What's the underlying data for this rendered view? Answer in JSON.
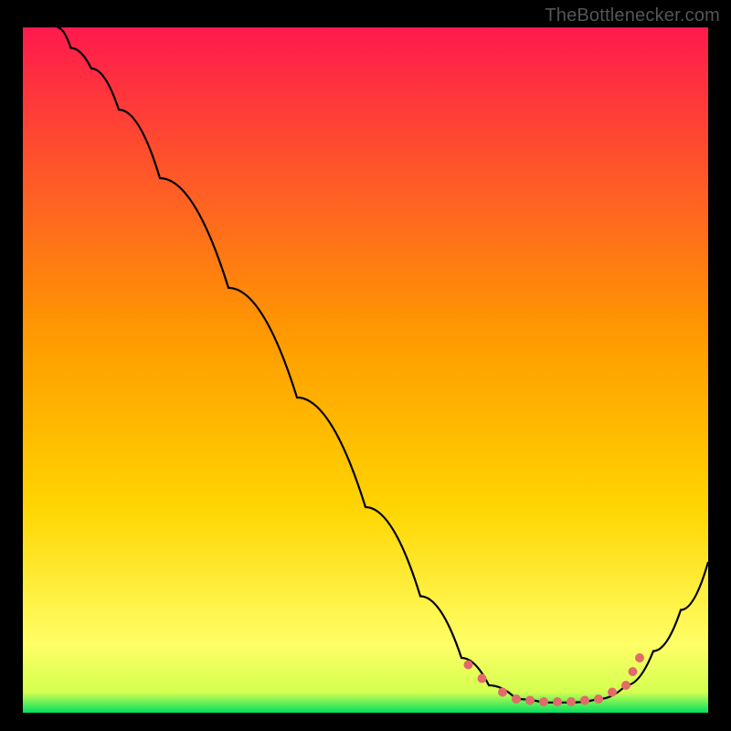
{
  "watermark": "TheBottlenecker.com",
  "chart_data": {
    "type": "line",
    "title": "",
    "xlabel": "",
    "ylabel": "",
    "x_range": [
      0,
      100
    ],
    "y_range": [
      0,
      100
    ],
    "background": {
      "top_color": "#ff1a4d",
      "mid_color": "#ffd500",
      "near_bottom_color": "#ffff66",
      "bottom_color": "#00e060"
    },
    "series": [
      {
        "name": "bottleneck-curve",
        "color": "#000000",
        "points": [
          {
            "x": 5,
            "y": 100
          },
          {
            "x": 7,
            "y": 97
          },
          {
            "x": 10,
            "y": 94
          },
          {
            "x": 14,
            "y": 88
          },
          {
            "x": 20,
            "y": 78
          },
          {
            "x": 30,
            "y": 62
          },
          {
            "x": 40,
            "y": 46
          },
          {
            "x": 50,
            "y": 30
          },
          {
            "x": 58,
            "y": 17
          },
          {
            "x": 64,
            "y": 8
          },
          {
            "x": 68,
            "y": 4
          },
          {
            "x": 72,
            "y": 2
          },
          {
            "x": 76,
            "y": 1.5
          },
          {
            "x": 80,
            "y": 1.5
          },
          {
            "x": 84,
            "y": 2
          },
          {
            "x": 88,
            "y": 4
          },
          {
            "x": 92,
            "y": 9
          },
          {
            "x": 96,
            "y": 15
          },
          {
            "x": 100,
            "y": 22
          }
        ]
      },
      {
        "name": "optimal-zone-markers",
        "type": "scatter",
        "color": "#e26a6a",
        "points": [
          {
            "x": 65,
            "y": 7
          },
          {
            "x": 67,
            "y": 5
          },
          {
            "x": 70,
            "y": 3
          },
          {
            "x": 72,
            "y": 2
          },
          {
            "x": 74,
            "y": 1.8
          },
          {
            "x": 76,
            "y": 1.6
          },
          {
            "x": 78,
            "y": 1.6
          },
          {
            "x": 80,
            "y": 1.6
          },
          {
            "x": 82,
            "y": 1.8
          },
          {
            "x": 84,
            "y": 2
          },
          {
            "x": 86,
            "y": 3
          },
          {
            "x": 88,
            "y": 4
          },
          {
            "x": 89,
            "y": 6
          },
          {
            "x": 90,
            "y": 8
          }
        ]
      }
    ]
  }
}
